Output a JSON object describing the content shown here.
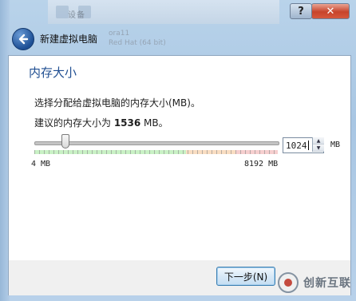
{
  "window": {
    "help_label": "?",
    "close_label": "✕",
    "bg_ghost_text": "设备"
  },
  "header": {
    "title": "新建虚拟电脑",
    "ghost_lines": [
      "ora11",
      "Red Hat (64 bit)"
    ]
  },
  "section": {
    "title": "内存大小",
    "description": "选择分配给虚拟电脑的内存大小(MB)。",
    "suggest_prefix": "建议的内存大小为 ",
    "suggest_value": "1536",
    "suggest_suffix": " MB。"
  },
  "memory": {
    "value": "1024",
    "unit": "MB",
    "min_label": "4 MB",
    "max_label": "8192 MB",
    "min": 4,
    "max": 8192,
    "current": 1024,
    "spin_up": "▲",
    "spin_down": "▼"
  },
  "footer": {
    "next_label": "下一步(N)"
  },
  "logo": {
    "text": "创新互联"
  },
  "colors": {
    "accent_title": "#1f4e91",
    "zone_green": "#c9f1c5",
    "zone_orange": "#f9ddc2",
    "zone_red": "#f6cfcf",
    "close_red": "#c7442b"
  }
}
